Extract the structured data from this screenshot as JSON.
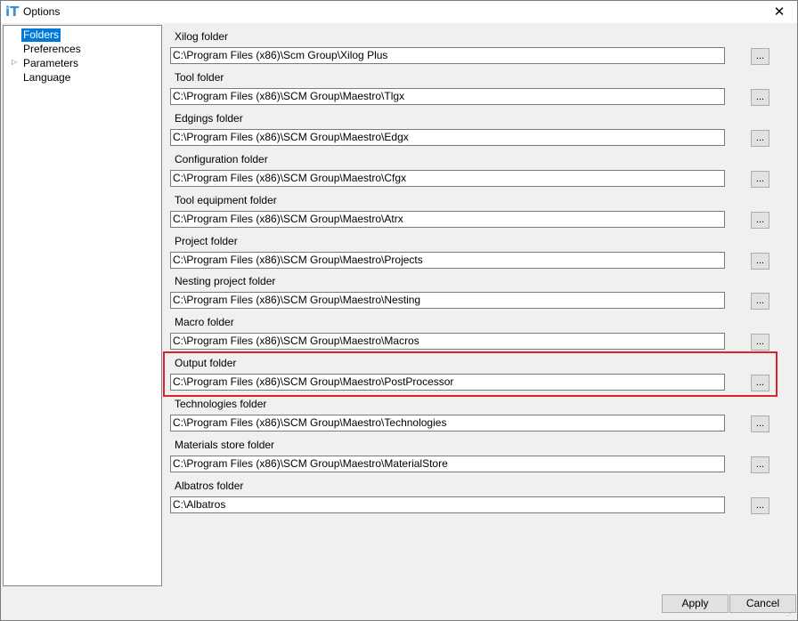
{
  "window": {
    "title": "Options",
    "app_icon": "iT",
    "close_glyph": "✕"
  },
  "tree": {
    "items": [
      {
        "label": "Folders",
        "selected": true,
        "expandable": false
      },
      {
        "label": "Preferences",
        "selected": false,
        "expandable": false
      },
      {
        "label": "Parameters",
        "selected": false,
        "expandable": true
      },
      {
        "label": "Language",
        "selected": false,
        "expandable": false
      }
    ],
    "expander_glyph": "▷"
  },
  "folders": [
    {
      "label": "Xilog folder",
      "value": "C:\\Program Files (x86)\\Scm Group\\Xilog Plus"
    },
    {
      "label": "Tool folder",
      "value": "C:\\Program Files (x86)\\SCM Group\\Maestro\\Tlgx"
    },
    {
      "label": "Edgings folder",
      "value": "C:\\Program Files (x86)\\SCM Group\\Maestro\\Edgx"
    },
    {
      "label": "Configuration folder",
      "value": "C:\\Program Files (x86)\\SCM Group\\Maestro\\Cfgx"
    },
    {
      "label": "Tool equipment folder",
      "value": "C:\\Program Files (x86)\\SCM Group\\Maestro\\Atrx"
    },
    {
      "label": "Project folder",
      "value": "C:\\Program Files (x86)\\SCM Group\\Maestro\\Projects"
    },
    {
      "label": "Nesting project folder",
      "value": "C:\\Program Files (x86)\\SCM Group\\Maestro\\Nesting"
    },
    {
      "label": "Macro folder",
      "value": "C:\\Program Files (x86)\\SCM Group\\Maestro\\Macros"
    },
    {
      "label": "Output folder",
      "value": "C:\\Program Files (x86)\\SCM Group\\Maestro\\PostProcessor"
    },
    {
      "label": "Technologies folder",
      "value": "C:\\Program Files (x86)\\SCM Group\\Maestro\\Technologies"
    },
    {
      "label": "Materials store folder",
      "value": "C:\\Program Files (x86)\\SCM Group\\Maestro\\MaterialStore"
    },
    {
      "label": "Albatros folder",
      "value": "C:\\Albatros"
    }
  ],
  "browse_label": "...",
  "highlighted_folder": "Output folder",
  "highlight_color": "#d9222a",
  "buttons": {
    "apply": "Apply",
    "cancel": "Cancel"
  }
}
